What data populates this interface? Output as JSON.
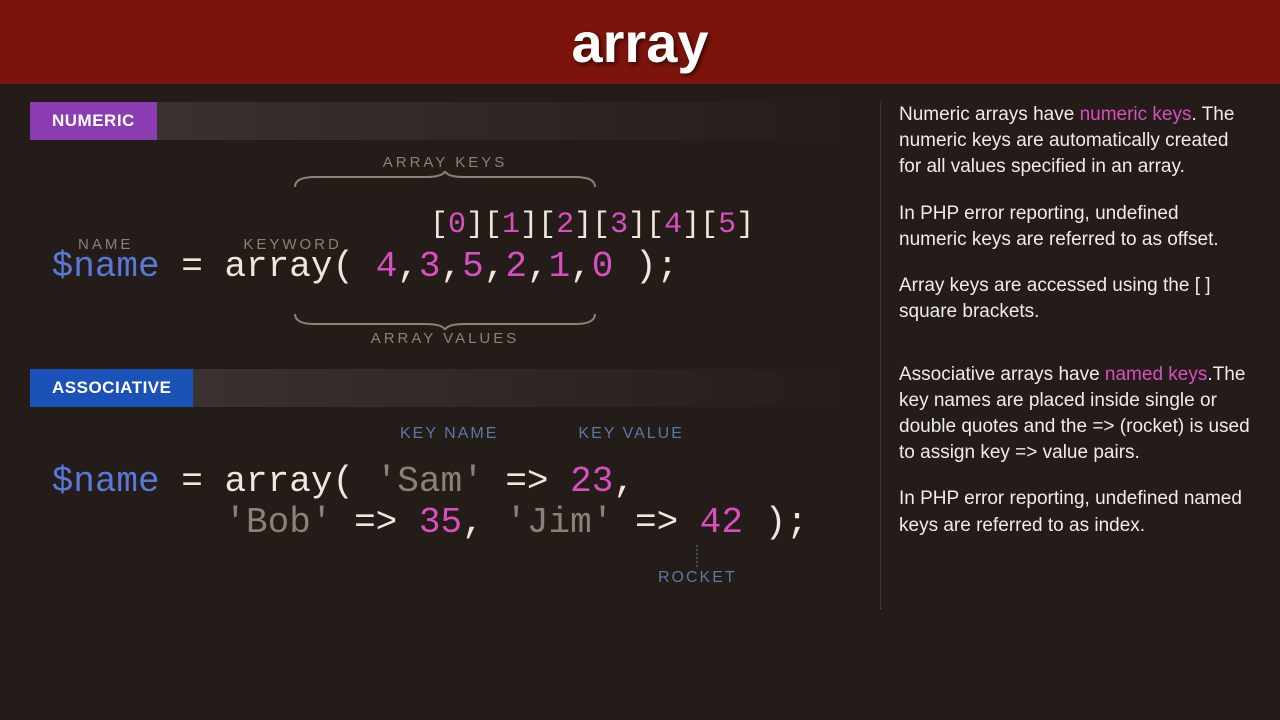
{
  "title": "array",
  "numeric": {
    "tab": "NUMERIC",
    "annot_top": "ARRAY KEYS",
    "annot_name": "NAME",
    "annot_keyword": "KEYWORD",
    "annot_bottom": "ARRAY VALUES",
    "code": {
      "var": "$name",
      "eq": " = ",
      "kw": "array( ",
      "vals": [
        "4",
        "3",
        "5",
        "2",
        "1",
        "0"
      ],
      "close": " );",
      "keys": [
        "0",
        "1",
        "2",
        "3",
        "4",
        "5"
      ]
    }
  },
  "assoc": {
    "tab": "ASSOCIATIVE",
    "annot_keyname": "KEY NAME",
    "annot_keyvalue": "KEY VALUE",
    "annot_rocket": "ROCKET",
    "code": {
      "var": "$name",
      "eq": " = ",
      "kw": "array( ",
      "pairs": [
        {
          "k": "'Sam'",
          "v": "23"
        },
        {
          "k": "'Bob'",
          "v": "35"
        },
        {
          "k": "'Jim'",
          "v": "42"
        }
      ],
      "arrow": " => ",
      "close": " );"
    }
  },
  "sidebar": {
    "p1a": "Numeric arrays have ",
    "p1hl": "numeric keys",
    "p1b": ". The numeric keys are automatically created for all values specified in an array.",
    "p2": "In PHP error reporting, undefined numeric keys are referred to as offset.",
    "p3": "Array keys are accessed using the [  ] square brackets.",
    "p4a": "Associative arrays have ",
    "p4hl": "named keys",
    "p4b": ".The key names are placed inside single or double quotes and the => (rocket) is used to assign key => value pairs.",
    "p5": "In PHP error reporting, undefined named keys are referred to as index."
  }
}
